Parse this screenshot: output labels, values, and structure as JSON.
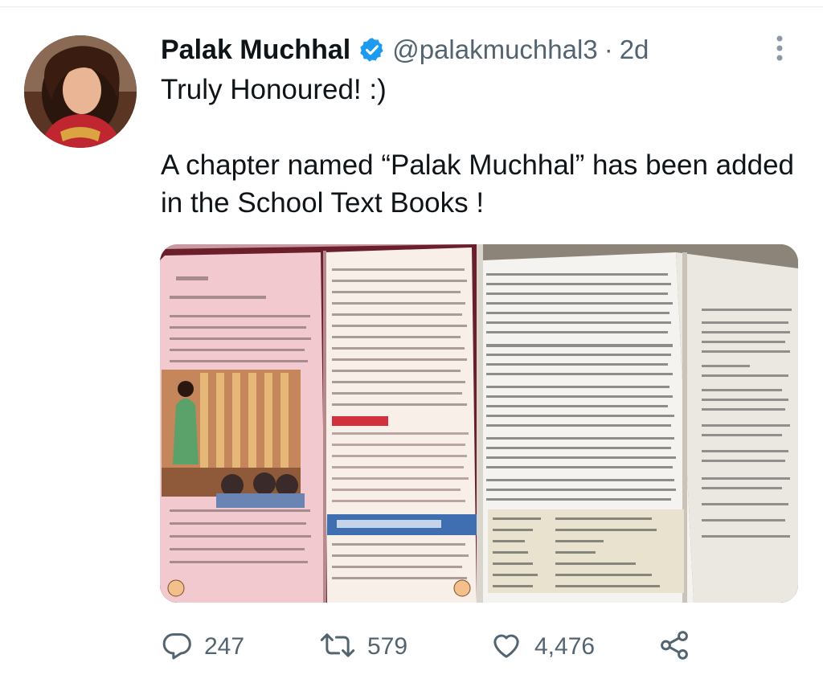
{
  "tweet": {
    "author_name": "Palak Muchhal",
    "handle": "@palakmuchhal3",
    "separator": "·",
    "time": "2d",
    "text_line1": "Truly Honoured! :)",
    "text_line2": "A chapter named “Palak Muchhal” has been added in the School Text Books !"
  },
  "media": {
    "left_photo_icon": "hindi-textbook-photo",
    "right_photo_icon": "english-textbook-photo"
  },
  "actions": {
    "reply_count": "247",
    "retweet_count": "579",
    "like_count": "4,476"
  },
  "colors": {
    "text_primary": "#0f1419",
    "text_secondary": "#536471",
    "verified_blue": "#1d9bf0"
  }
}
